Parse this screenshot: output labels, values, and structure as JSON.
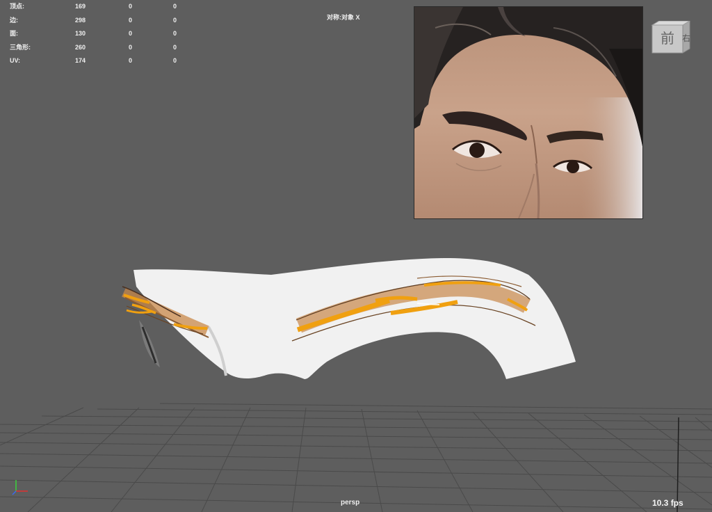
{
  "hud": {
    "stats": [
      {
        "label": "顶点:",
        "v1": "169",
        "v2": "0",
        "v3": "0"
      },
      {
        "label": "边:",
        "v1": "298",
        "v2": "0",
        "v3": "0"
      },
      {
        "label": "面:",
        "v1": "130",
        "v2": "0",
        "v3": "0"
      },
      {
        "label": "三角形:",
        "v1": "260",
        "v2": "0",
        "v3": "0"
      },
      {
        "label": "UV:",
        "v1": "174",
        "v2": "0",
        "v3": "0"
      }
    ],
    "symmetry": "对称:对象 X"
  },
  "view_cube": {
    "front_label": "前",
    "right_label": "右"
  },
  "viewport": {
    "camera_label": "persp",
    "fps": "10.3 fps"
  },
  "colors": {
    "viewport_bg": "#5e5e5e",
    "grid_line": "#474747",
    "mesh_surface": "#f2f2f2",
    "eyebrow_curve": "#f0a010",
    "eyebrow_hair": "#c88a4a"
  }
}
